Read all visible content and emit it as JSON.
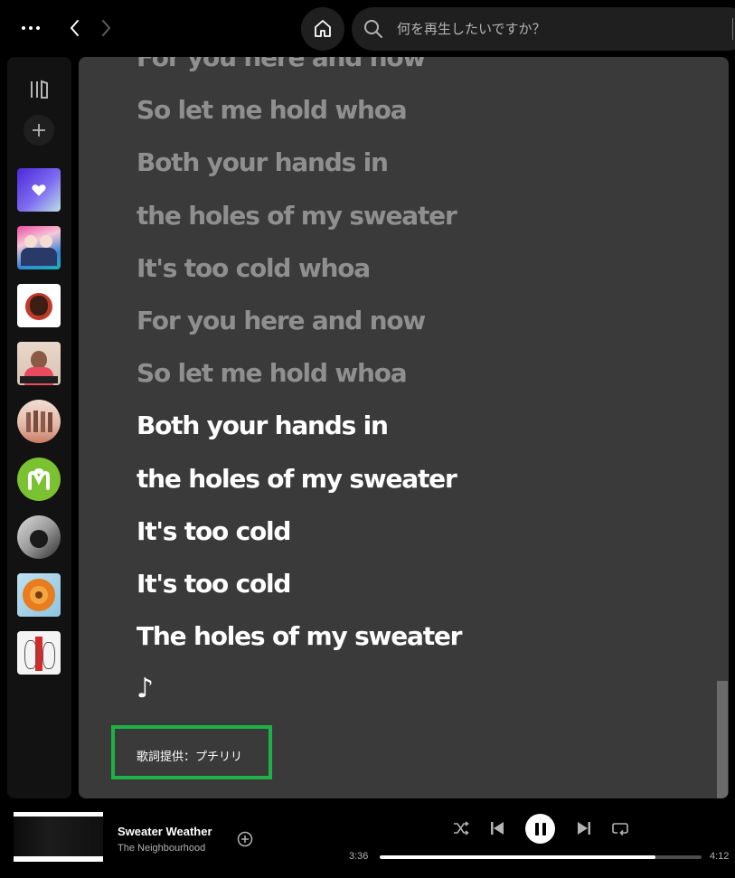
{
  "search": {
    "placeholder": "何を再生したいですか？"
  },
  "sidebar": {
    "items": [
      {
        "name": "liked-songs",
        "shape": "square"
      },
      {
        "name": "playlist-1",
        "shape": "square"
      },
      {
        "name": "podcast-1",
        "shape": "square"
      },
      {
        "name": "podcast-2",
        "shape": "square"
      },
      {
        "name": "artist-1",
        "shape": "round"
      },
      {
        "name": "artist-2",
        "shape": "round"
      },
      {
        "name": "artist-3",
        "shape": "round"
      },
      {
        "name": "album-1",
        "shape": "square"
      },
      {
        "name": "album-2",
        "shape": "square"
      }
    ]
  },
  "lyrics": {
    "lines": [
      {
        "text": "For you here and now",
        "state": "past"
      },
      {
        "text": "So let me hold whoa",
        "state": "past"
      },
      {
        "text": "Both your hands in",
        "state": "past"
      },
      {
        "text": "the holes of my sweater",
        "state": "past"
      },
      {
        "text": "It's too cold whoa",
        "state": "past"
      },
      {
        "text": "For you here and now",
        "state": "past"
      },
      {
        "text": "So let me hold whoa",
        "state": "past"
      },
      {
        "text": "Both your hands in",
        "state": "current"
      },
      {
        "text": "the holes of my sweater",
        "state": "current"
      },
      {
        "text": "It's too cold",
        "state": "current"
      },
      {
        "text": "It's too cold",
        "state": "current"
      },
      {
        "text": "The holes of my sweater",
        "state": "current"
      }
    ],
    "note": "♪",
    "provider": "歌詞提供：プチリリ"
  },
  "player": {
    "title": "Sweater Weather",
    "artist": "The Neighbourhood",
    "current_time": "3:36",
    "total_time": "4:12",
    "progress": 0.857
  },
  "colors": {
    "accent": "#1db245",
    "panel": "#3a3a3a",
    "past_lyric": "#8f8f8f",
    "current_lyric": "#ffffff"
  }
}
